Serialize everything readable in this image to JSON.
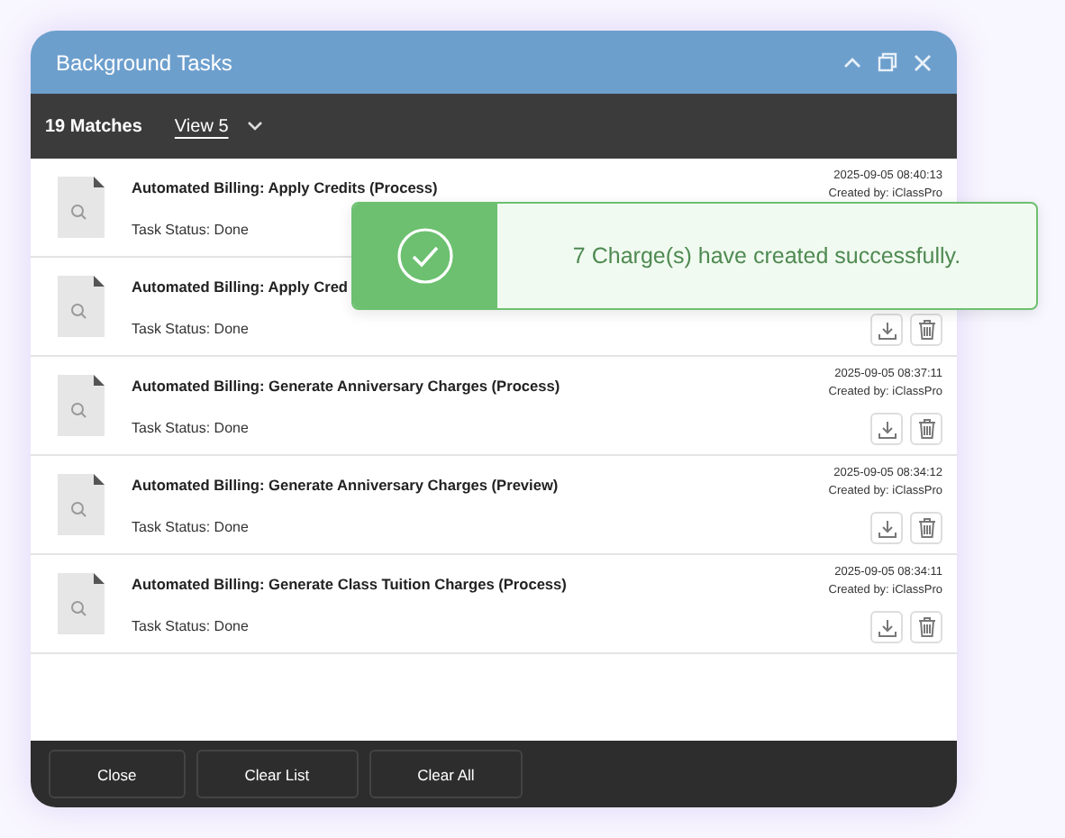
{
  "window": {
    "title": "Background Tasks"
  },
  "toolbar": {
    "matches": "19 Matches",
    "view": "View 5"
  },
  "tasks": [
    {
      "title": "Automated Billing: Apply Credits (Process)",
      "status": "Task Status: Done",
      "timestamp": "2025-09-05 08:40:13",
      "created_by": "Created by: iClassPro"
    },
    {
      "title": "Automated Billing: Apply Cred",
      "status": "Task Status: Done",
      "actions": [
        {
          "kind": "download"
        },
        {
          "kind": "delete"
        }
      ]
    },
    {
      "title": "Automated Billing: Generate Anniversary Charges (Process)",
      "status": "Task Status: Done",
      "timestamp": "2025-09-05 08:37:11",
      "created_by": "Created by: iClassPro",
      "actions": [
        {
          "kind": "download"
        },
        {
          "kind": "delete"
        }
      ]
    },
    {
      "title": "Automated Billing: Generate Anniversary Charges (Preview)",
      "status": "Task Status: Done",
      "timestamp": "2025-09-05 08:34:12",
      "created_by": "Created by: iClassPro",
      "actions": [
        {
          "kind": "download"
        },
        {
          "kind": "delete"
        }
      ]
    },
    {
      "title": "Automated Billing: Generate Class Tuition Charges (Process)",
      "status": "Task Status: Done",
      "timestamp": "2025-09-05 08:34:11",
      "created_by": "Created by: iClassPro",
      "actions": [
        {
          "kind": "download"
        },
        {
          "kind": "delete"
        }
      ]
    }
  ],
  "footer_buttons": [
    "Close",
    "Clear List",
    "Clear All"
  ],
  "toast": {
    "message": "7 Charge(s) have created successfully."
  }
}
